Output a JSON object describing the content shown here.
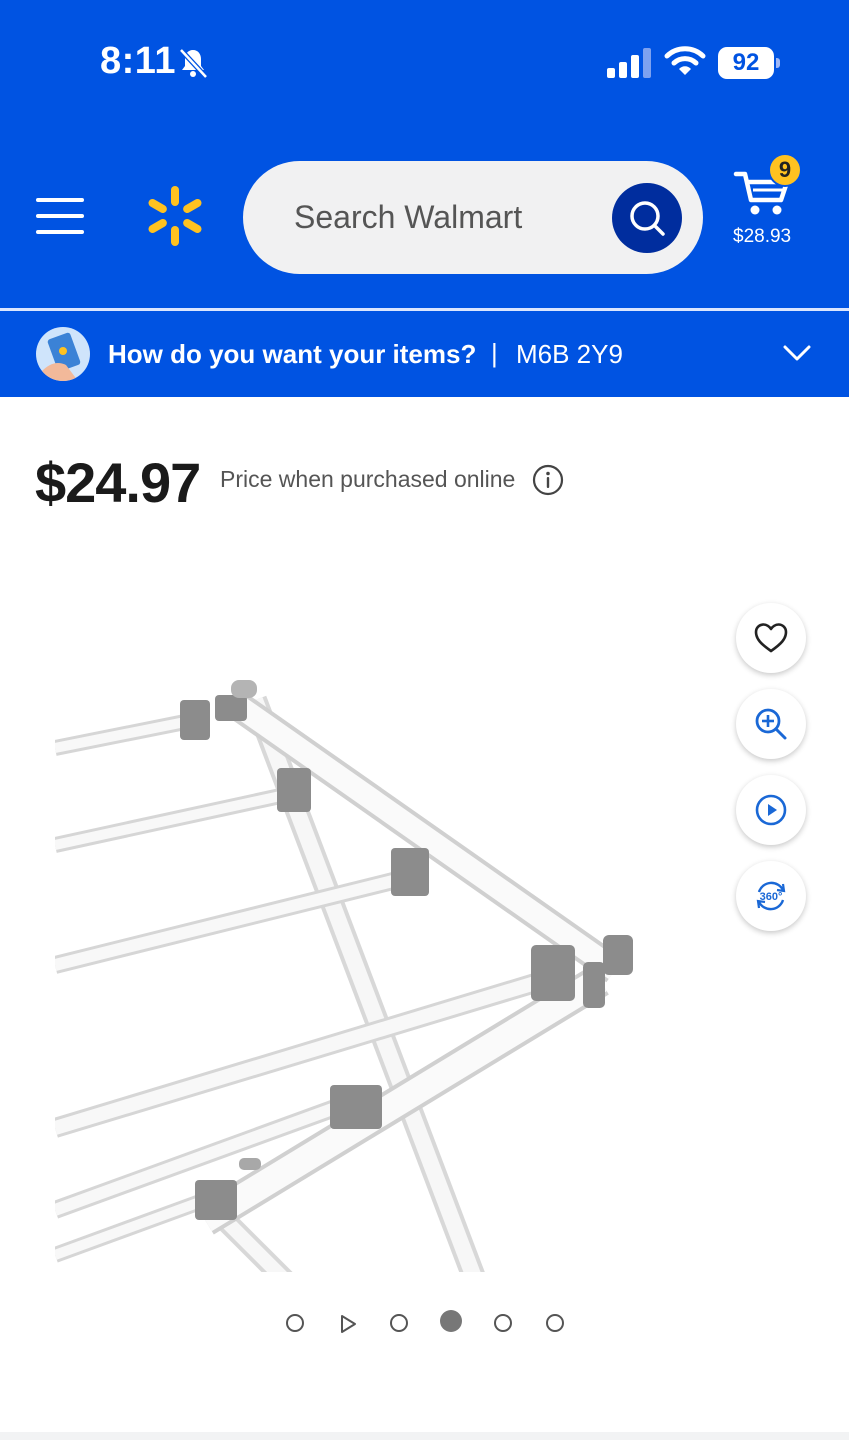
{
  "status_bar": {
    "time": "8:11",
    "battery": "92"
  },
  "header": {
    "search_placeholder": "Search Walmart",
    "cart_count": "9",
    "cart_total": "$28.93"
  },
  "delivery": {
    "question": "How do you want your items?",
    "separator": "|",
    "postal_code": "M6B 2Y9"
  },
  "product": {
    "price": "$24.97",
    "price_note": "Price when purchased online"
  },
  "media_actions": [
    "heart-icon",
    "zoom-in-icon",
    "play-icon",
    "360-view-icon"
  ],
  "carousel": {
    "total": 6,
    "active_index": 3
  },
  "colors": {
    "brand_blue": "#0053e2",
    "spark_yellow": "#ffc220",
    "search_btn": "#002d9e"
  }
}
